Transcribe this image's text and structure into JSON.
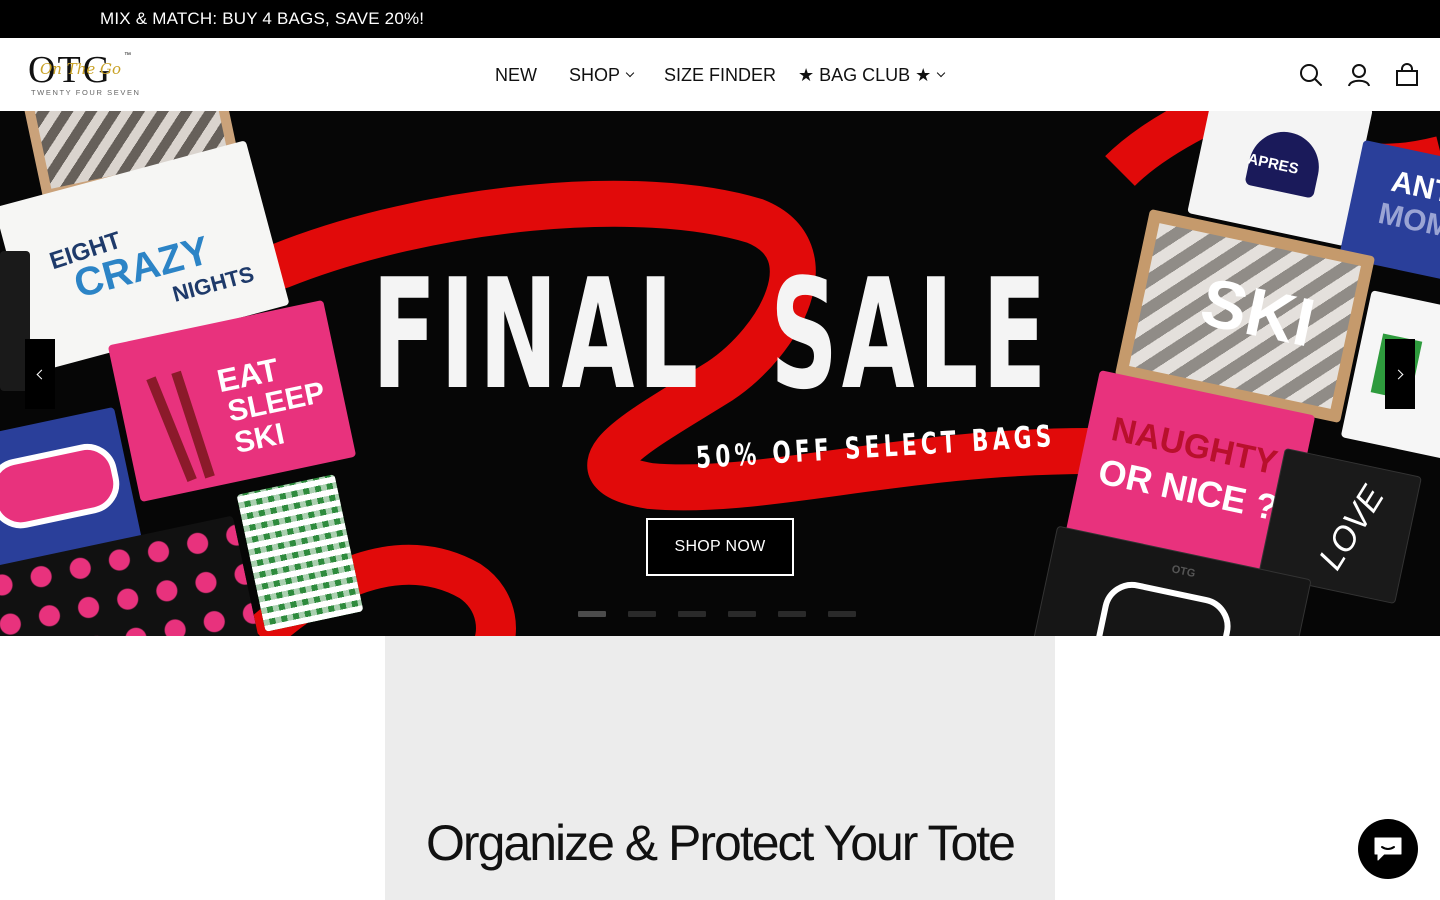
{
  "announcement": {
    "text": "MIX & MATCH: BUY 4 BAGS, SAVE 20%!"
  },
  "logo": {
    "main": "OTG",
    "script": "On The Go",
    "tm": "™",
    "subtitle": "TWENTY FOUR SEVEN"
  },
  "nav": {
    "items": [
      {
        "label": "NEW",
        "dropdown": false
      },
      {
        "label": "SHOP",
        "dropdown": true
      },
      {
        "label": "SIZE FINDER",
        "dropdown": false
      },
      {
        "label": "★ BAG CLUB ★",
        "dropdown": true
      }
    ]
  },
  "header_icons": [
    "search-icon",
    "account-icon",
    "cart-icon"
  ],
  "hero": {
    "headline_left": "FINAL",
    "headline_right": "SALE",
    "ribbon_text": "50% OFF SELECT BAGS",
    "cta_label": "SHOP NOW",
    "slide_count": 6,
    "active_slide": 1,
    "pouch_labels": {
      "eight": "EIGHT",
      "crazy": "CRAZY",
      "nights": "NIGHTS",
      "eat": "EAT",
      "sleep": "SLEEP",
      "ski_small": "SKI",
      "ski_big": "SKI",
      "apres": "APRES",
      "naughty": "NAUGHTY",
      "ornice": "OR NICE ?",
      "love": "love",
      "anti": "ANTI",
      "mom": "MOM",
      "otg": "OTG"
    },
    "colors": {
      "background": "#060606",
      "ribbon": "#e10a0a",
      "pink": "#e8327d",
      "navy": "#2a3f9a"
    }
  },
  "promo": {
    "heading": "Organize & Protect Your Tote"
  },
  "chat": {
    "icon": "chat-icon"
  }
}
